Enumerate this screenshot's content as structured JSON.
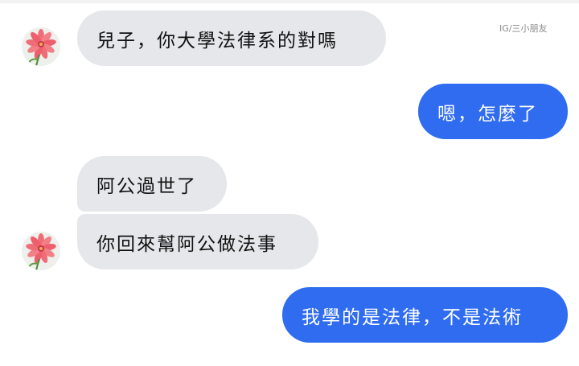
{
  "watermark": "IG/三小朋友",
  "messages": [
    {
      "sender": "contact",
      "text": "兒子，你大學法律系的對嗎"
    },
    {
      "sender": "me",
      "text": "嗯，怎麼了"
    },
    {
      "sender": "contact",
      "text": "阿公過世了"
    },
    {
      "sender": "contact",
      "text": "你回來幫阿公做法事"
    },
    {
      "sender": "me",
      "text": "我學的是法律，不是法術"
    }
  ],
  "colors": {
    "incoming_bubble": "#e6e7ea",
    "outgoing_bubble": "#2f6cf0",
    "outgoing_text": "#ffffff",
    "incoming_text": "#111111"
  },
  "avatar_icon": "pink-flower-icon"
}
